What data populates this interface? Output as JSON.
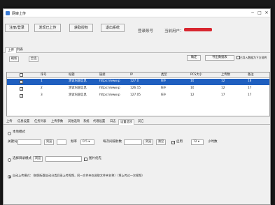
{
  "window": {
    "title": "网审上传"
  },
  "toolbar": {
    "buttons": [
      "注册/登录",
      "发现已上传",
      "获取授权",
      "退出系统"
    ],
    "account_label": "登录账号",
    "user_label": "当前用户："
  },
  "top_tabs": [
    "上传",
    "列表"
  ],
  "subtoolbar": {
    "left_buttons": [
      "刷新",
      "全选"
    ],
    "right_buttons": [
      "确定",
      "导出数据表",
      "已导入数据为下方说明"
    ]
  },
  "grid": {
    "headers": [
      "",
      "序号",
      "标题",
      "链接",
      "IP",
      "类型",
      "PCS大小",
      "上传数",
      "备注"
    ],
    "rows": [
      {
        "checked": true,
        "index": "1",
        "title": "测试内容信息",
        "url": "https://www.p",
        "ip": "127.0",
        "type": "IE9",
        "size": "10",
        "count": "12",
        "note": "18"
      },
      {
        "checked": true,
        "index": "2",
        "title": "测试内容信息",
        "url": "https://www.p",
        "ip": "126.15",
        "type": "IE9",
        "size": "10",
        "count": "12",
        "note": "17"
      },
      {
        "checked": true,
        "index": "3",
        "title": "测试内容信息",
        "url": "https://www.p",
        "ip": "127.05",
        "type": "IE9",
        "size": "12",
        "count": "17",
        "note": "17"
      }
    ]
  },
  "bottom_tabs": [
    "上传",
    "信息设置",
    "任务列表",
    "上传参数",
    "其他选项",
    "系统",
    "代理设置",
    "日志",
    "设置选项",
    "其它"
  ],
  "settings": {
    "radio1_label": "本地模式",
    "row2": {
      "label1": "关键词",
      "btn1": "浏览",
      "label2": "频率",
      "select_val": "0.5",
      "label3": "每次间隔秒数",
      "btn2": "浏览",
      "btn3": "清空",
      "chk_label": "启用",
      "num_val": "72",
      "label4": "小时数"
    },
    "radio2_label": "选择目录模式",
    "radio2_btn": "浏览",
    "chk2_label": "图片优先",
    "radio3_label": "自动上传模式：（按照标题自动分类目录上传视频，同一文件夹仅选取文件夹名称）（将上传过一次视频）"
  },
  "colors": {
    "accent": "#1f5fbf",
    "redbar": "#d8262f"
  }
}
